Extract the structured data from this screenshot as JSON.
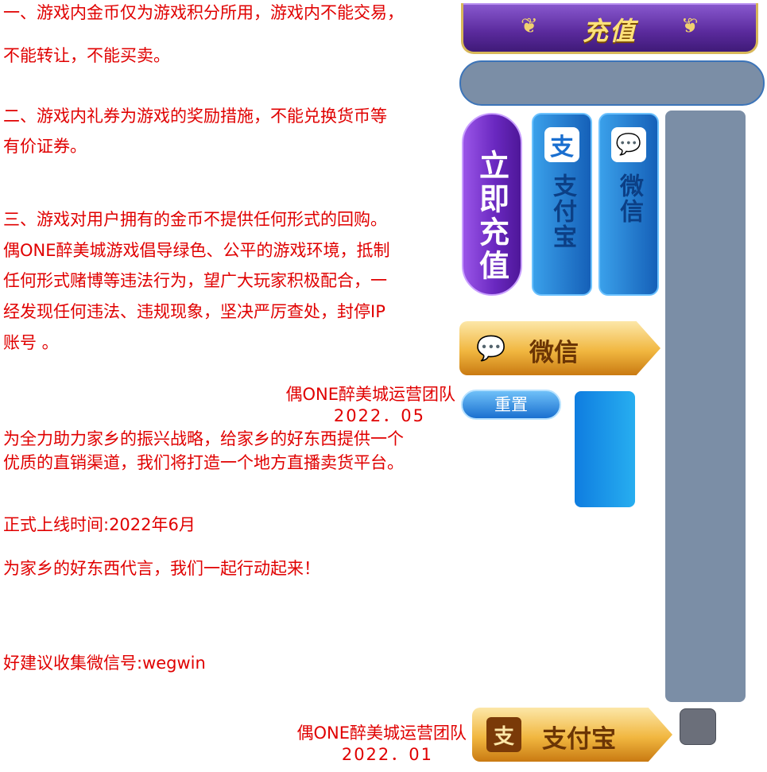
{
  "header": {
    "title": "充值",
    "laurel_glyph": "❦"
  },
  "notice": {
    "line1": "一、游戏内金币仅为游戏积分所用，游戏内不能交易，",
    "line2": "不能转让，不能买卖。",
    "line3": "二、游戏内礼券为游戏的奖励措施，不能兑换货币等",
    "line4": "有价证券。",
    "line5": "三、游戏对用户拥有的金币不提供任何形式的回购。",
    "line6": "偶ONE醉美城游戏倡导绿色、公平的游戏环境，抵制",
    "line7": "任何形式赌博等违法行为，望广大玩家积极配合，一",
    "line8": "经发现任何违法、违规现象，坚决严厉查处，封停IP",
    "line9": "账号 。",
    "signature1": "偶ONE醉美城运营团队",
    "date1": "2022．05",
    "line10": "为全力助力家乡的振兴战略，给家乡的好东西提供一个",
    "line11": "优质的直销渠道，我们将打造一个地方直播卖货平台。",
    "line12": "正式上线时间:2022年6月",
    "line13": "为家乡的好东西代言，我们一起行动起来！",
    "line14": "好建议收集微信号:wegwin",
    "signature2": "偶ONE醉美城运营团队",
    "date2": "2022．01"
  },
  "payment": {
    "recharge_now_label": "立即充值",
    "tabs": [
      {
        "label": "支付宝",
        "icon": "alipay-icon",
        "glyph": "支"
      },
      {
        "label": "微信",
        "icon": "wechat-icon",
        "glyph": "💬"
      }
    ],
    "wechat_button_label": "微信",
    "alipay_button_label": "支付宝",
    "reset_label": "重置",
    "wechat_glyph": "💬",
    "alipay_glyph": "支"
  },
  "colors": {
    "notice_text": "#e00000",
    "panel_gray": "#7b8ea6",
    "accent_purple": "#6a28c0",
    "accent_blue": "#1a70d0",
    "gold": "#f1b740"
  }
}
